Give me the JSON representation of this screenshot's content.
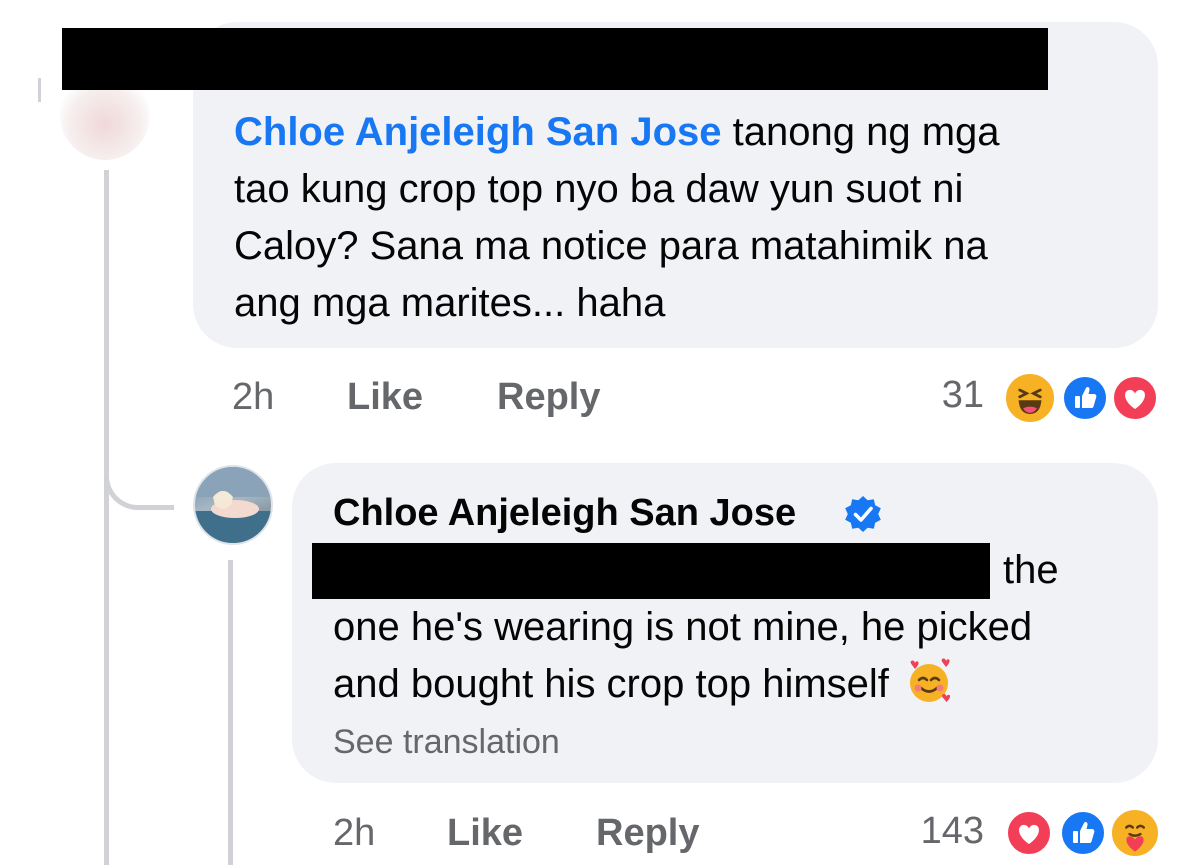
{
  "comment1": {
    "mention": "Chloe Anjeleigh San Jose",
    "line1_rest": " tanong ng mga",
    "line2": "tao kung crop top nyo ba daw yun suot ni",
    "line3": "Caloy? Sana ma notice para matahimik na",
    "line4": "ang mga marites... haha",
    "time": "2h",
    "like_label": "Like",
    "reply_label": "Reply",
    "reaction_count": "31",
    "reactions": [
      "haha-icon",
      "like-icon",
      "love-icon"
    ]
  },
  "comment2": {
    "author": "Chloe Anjeleigh San Jose",
    "verified_icon": "verified-badge-icon",
    "line1_end": "the",
    "line2": "one he's wearing is not mine, he picked",
    "line3": "and bought his crop top himself",
    "emoji": "smiling-face-with-hearts-icon",
    "see_translation": "See translation",
    "time": "2h",
    "like_label": "Like",
    "reply_label": "Reply",
    "reaction_count": "143",
    "reactions": [
      "love-icon",
      "like-icon",
      "care-icon"
    ]
  },
  "colors": {
    "link": "#1877f2",
    "bubble": "#f0f2f5",
    "meta": "#65676b",
    "love": "#f33e58",
    "haha": "#f7b125"
  }
}
